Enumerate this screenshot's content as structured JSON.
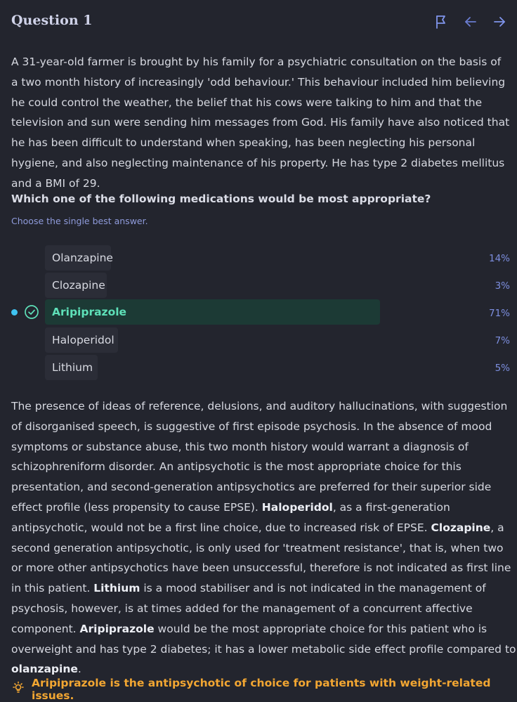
{
  "header": {
    "title": "Question 1",
    "icons": [
      "flag-icon",
      "arrow-left-icon",
      "arrow-right-icon"
    ]
  },
  "question": {
    "stem": "A 31-year-old farmer is brought by his family for a psychiatric consultation on the basis of a two month history of increasingly 'odd behaviour.' This behaviour included him believing he could control the weather, the belief that his cows were talking to him and that the television and sun were sending him messages from God. His family have also noticed that he has been difficult to understand when speaking, has been neglecting his personal hygiene, and also neglecting maintenance of his property. He has type 2 diabetes mellitus and a BMI of 29.",
    "prompt": "Which one of the following medications would be most appropriate?",
    "instruction": "Choose the single best answer."
  },
  "options": [
    {
      "label": "Olanzapine",
      "percent": "14%",
      "selected": false
    },
    {
      "label": "Clozapine",
      "percent": "3%",
      "selected": false
    },
    {
      "label": "Aripiprazole",
      "percent": "71%",
      "selected": true,
      "correct": true
    },
    {
      "label": "Haloperidol",
      "percent": "7%",
      "selected": false
    },
    {
      "label": "Lithium",
      "percent": "5%",
      "selected": false
    }
  ],
  "explanation": [
    {
      "text": "The presence of ideas of reference, delusions, and auditory hallucinations, with suggestion of disorganised speech, is suggestive of first episode psychosis. In the absence of mood symptoms or substance abuse, this two month history would warrant a diagnosis of schizophreniform disorder. An antipsychotic is the most appropriate choice for this presentation, and second-generation antipsychotics are preferred for their superior side effect profile (less propensity to cause EPSE). ",
      "bold": false
    },
    {
      "text": "Haloperidol",
      "bold": true
    },
    {
      "text": ", as a first-generation antipsychotic, would not be a first line choice, due to increased risk of EPSE. ",
      "bold": false
    },
    {
      "text": "Clozapine",
      "bold": true
    },
    {
      "text": ", a second generation antipsychotic, is only used for 'treatment resistance', that is, when two or more other antipsychotics have been unsuccessful, therefore is not indicated as first line in this patient. ",
      "bold": false
    },
    {
      "text": "Lithium",
      "bold": true
    },
    {
      "text": " is a mood stabiliser and is not indicated in the management of psychosis, however, is at times added for the management of a concurrent affective component. ",
      "bold": false
    },
    {
      "text": "Aripiprazole",
      "bold": true
    },
    {
      "text": " would be the most appropriate choice for this patient who is overweight and has type 2 diabetes; it has a lower metabolic side effect profile compared to ",
      "bold": false
    },
    {
      "text": "olanzapine",
      "bold": true
    },
    {
      "text": ".",
      "bold": false
    }
  ],
  "tip": {
    "icon": "lightbulb-icon",
    "text": "Aripiprazole is the antipsychotic of choice for patients with weight-related issues."
  },
  "colors": {
    "background": "#23252e",
    "accent": "#7d8fe0",
    "selected_bg": "#1c3a35",
    "selected_text": "#5ee0b8",
    "selected_dot": "#3fc3f0",
    "tip": "#f2a632"
  }
}
